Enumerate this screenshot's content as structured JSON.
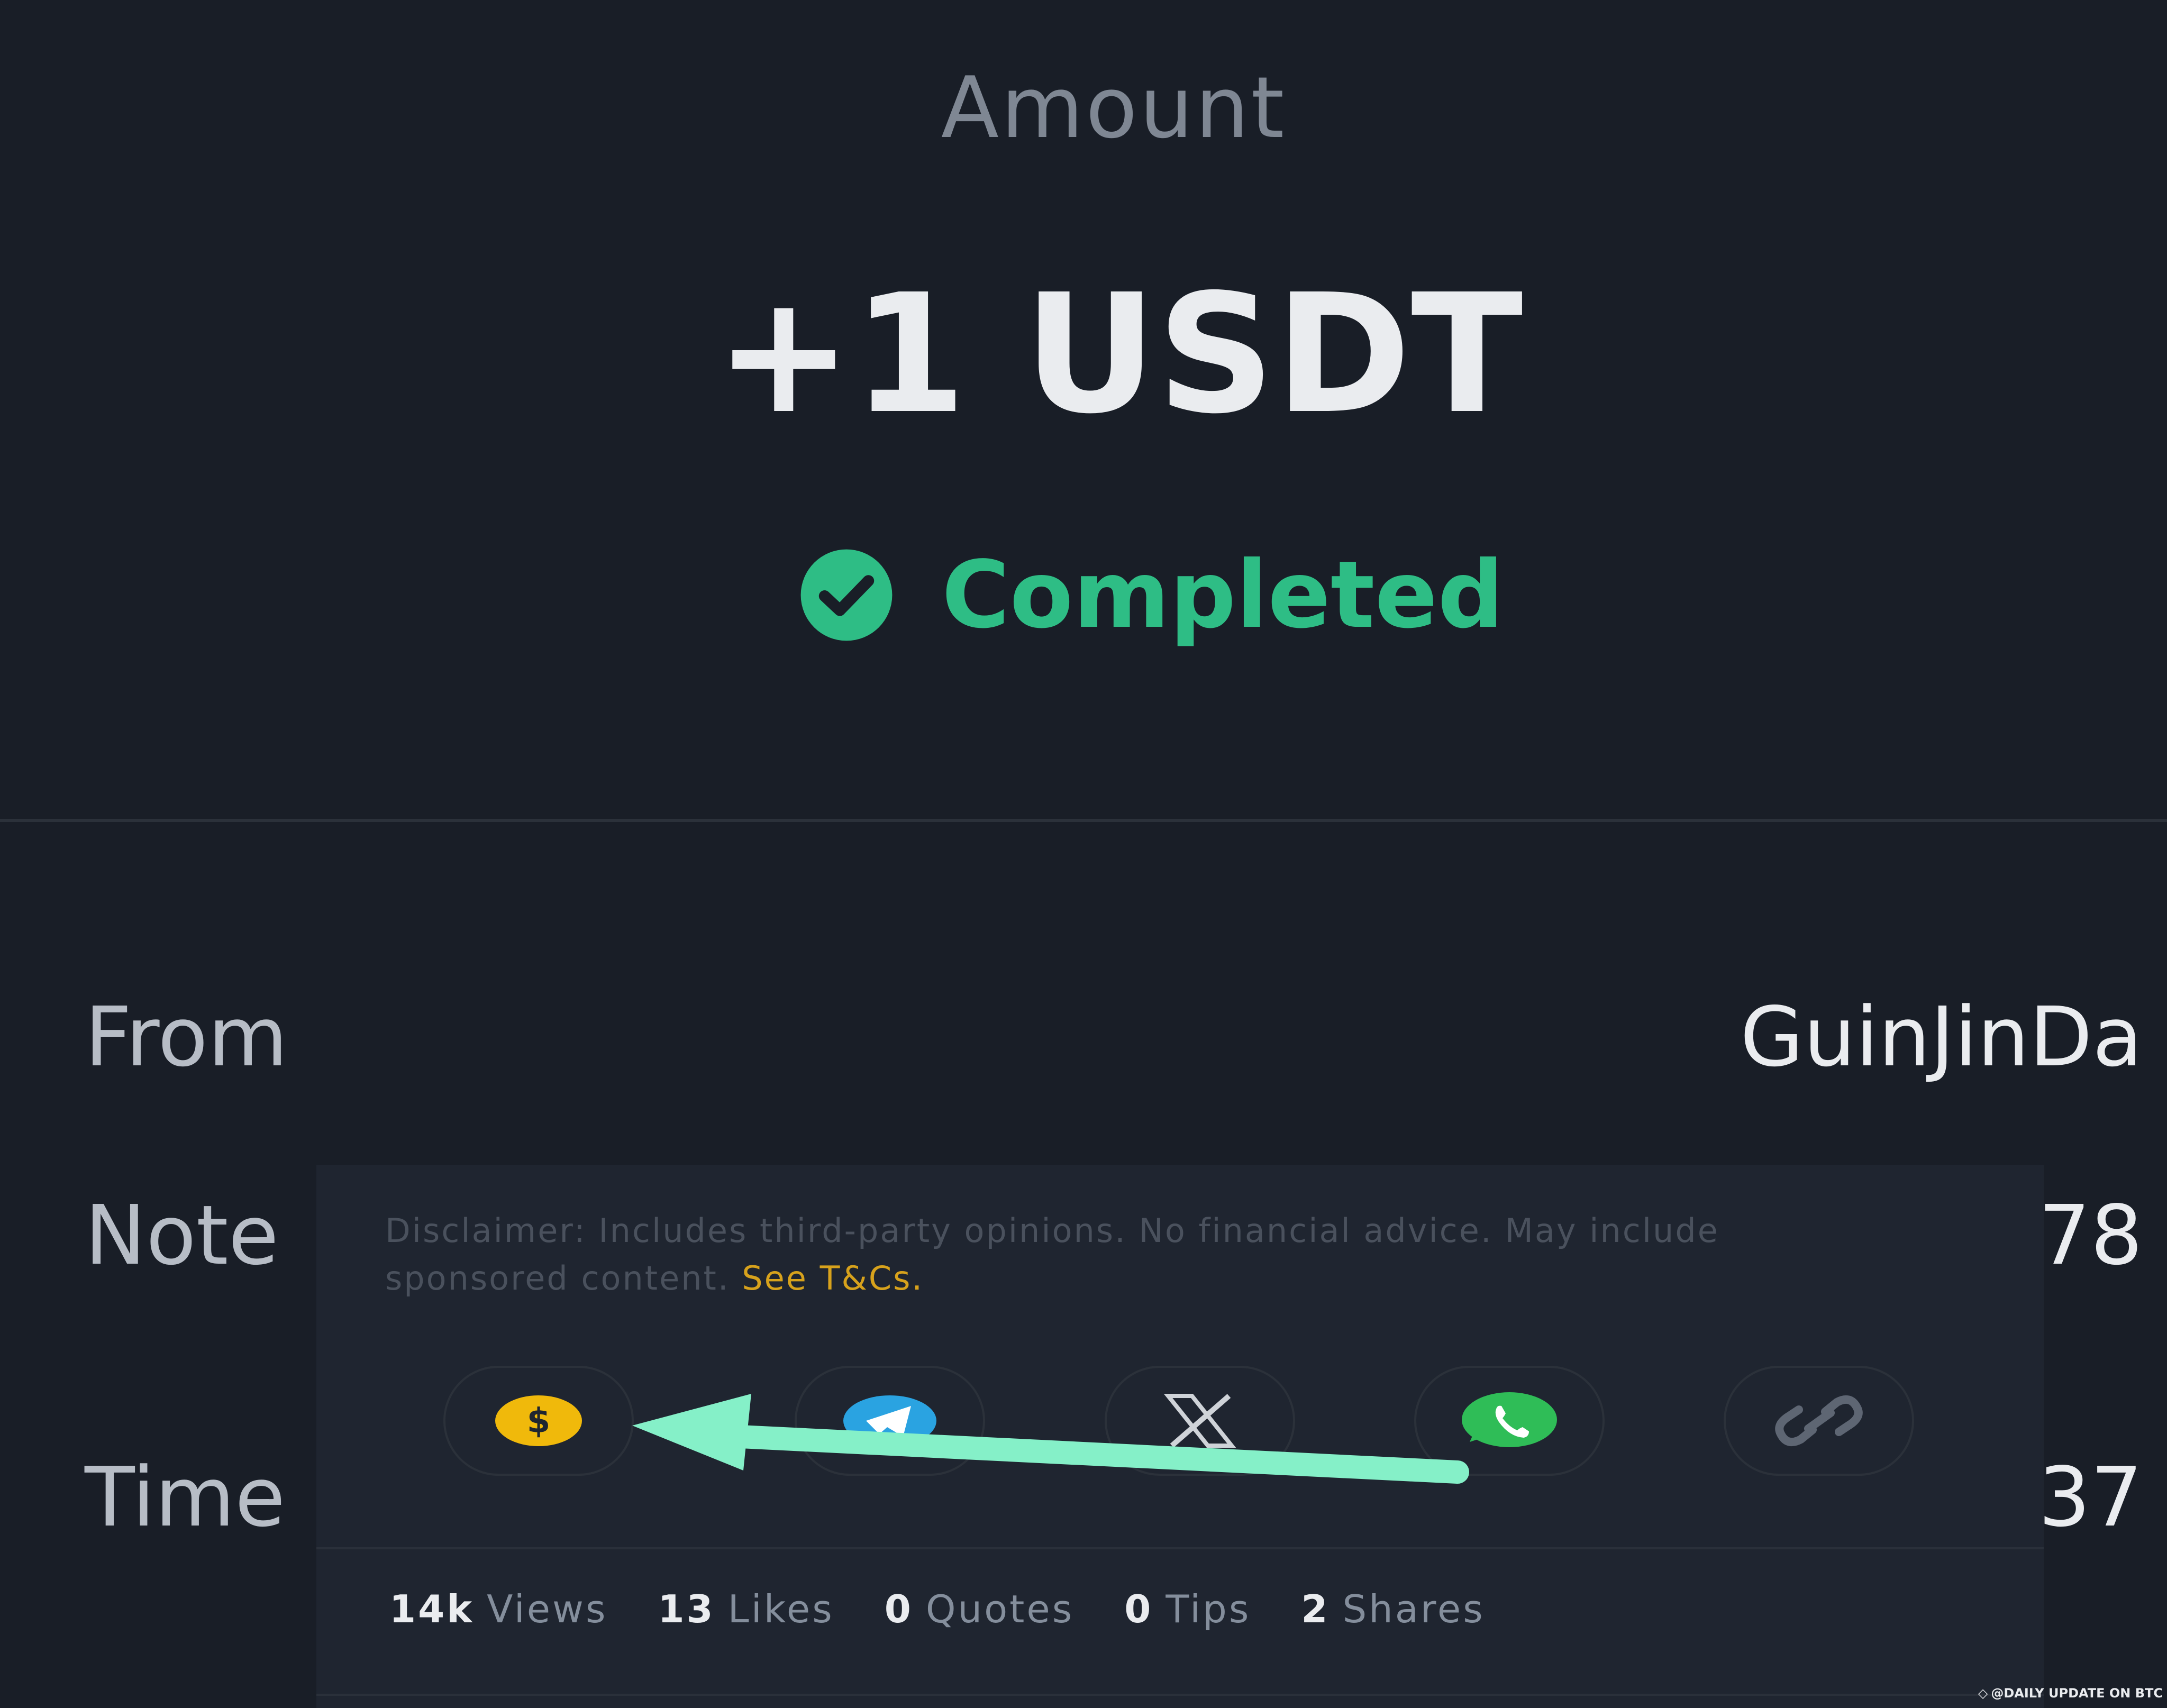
{
  "amount": {
    "label": "Amount",
    "value": "+1 USDT"
  },
  "status": {
    "text": "Completed",
    "color": "#2ebd85",
    "icon": "check-circle-icon"
  },
  "details": {
    "from_label": "From",
    "from_value": "GuinJinDa",
    "note_label": "Note",
    "note_value_partial": "78",
    "time_label": "Time",
    "time_value_partial": "37"
  },
  "post_panel": {
    "disclaimer": "Disclaimer: Includes third-party opinions. No financial advice. May include sponsored content.",
    "tc_link": "See T&Cs.",
    "share_buttons": [
      {
        "name": "tip",
        "icon": "dollar-coin-icon",
        "color": "#f0b90b"
      },
      {
        "name": "telegram",
        "icon": "telegram-icon",
        "color": "#2aa3e1"
      },
      {
        "name": "x",
        "icon": "x-logo-icon",
        "color": "#cfd3d8"
      },
      {
        "name": "whatsapp",
        "icon": "whatsapp-icon",
        "color": "#2fbd57"
      },
      {
        "name": "copy-link",
        "icon": "link-icon",
        "color": "#5e6673"
      }
    ],
    "stats": [
      {
        "num": "14k",
        "label": "Views"
      },
      {
        "num": "13",
        "label": "Likes"
      },
      {
        "num": "0",
        "label": "Quotes"
      },
      {
        "num": "0",
        "label": "Tips"
      },
      {
        "num": "2",
        "label": "Shares"
      }
    ]
  },
  "annotation": {
    "arrow_color": "#85f0c8"
  },
  "watermark": "@DAILY UPDATE ON BTC"
}
